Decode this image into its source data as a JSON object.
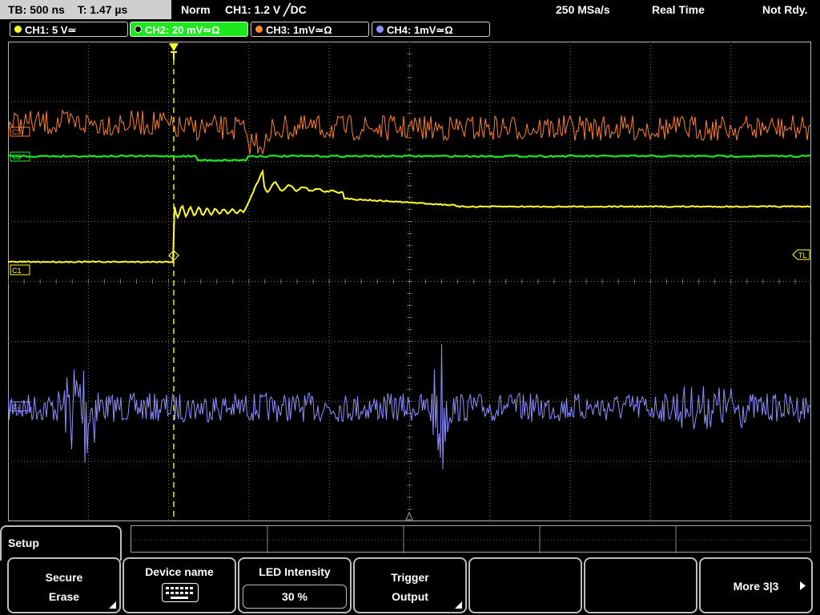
{
  "status_bar": {
    "timebase": "TB: 500 ns",
    "trigger_time": "T: 1.47 µs",
    "mode": "Norm",
    "trigger_setting": "CH1: 1.2 V ╱DC",
    "sample_rate": "250 MSa/s",
    "acq_mode": "Real Time",
    "state": "Not Rdy."
  },
  "channels": [
    {
      "label": "CH1: 5 V≃",
      "color": "#ffff2a",
      "active": false
    },
    {
      "label": "CH2: 20 mV≃Ω",
      "color": "#1de81d",
      "active": true
    },
    {
      "label": "CH3: 1mV≃Ω",
      "color": "#ff8a2a",
      "active": false
    },
    {
      "label": "CH4: 1mV≃Ω",
      "color": "#8f8fff",
      "active": false
    }
  ],
  "scope": {
    "ch1_marker": "C1",
    "ch2_marker": "C2",
    "ch3_marker": "C3",
    "ch4_marker": "C4",
    "trigger_level_marker": "TL",
    "colors": {
      "ch1": "#ffff2a",
      "ch2": "#1de81d",
      "ch3": "#ff7f2a",
      "ch4": "#8f8fff",
      "grid": "#7a7a7a"
    }
  },
  "menu": {
    "title": "Setup",
    "softkeys": [
      {
        "line1": "Secure",
        "line2": "Erase",
        "has_submenu": true
      },
      {
        "line1": "Device name",
        "icon": "keyboard-icon"
      },
      {
        "line1": "LED Intensity",
        "value": "30 %"
      },
      {
        "line1": "Trigger",
        "line2": "Output",
        "has_submenu": true
      },
      {
        "line1": ""
      },
      {
        "line1": ""
      },
      {
        "line1": "More 3|3",
        "icon": "right-arrow-icon"
      }
    ]
  }
}
